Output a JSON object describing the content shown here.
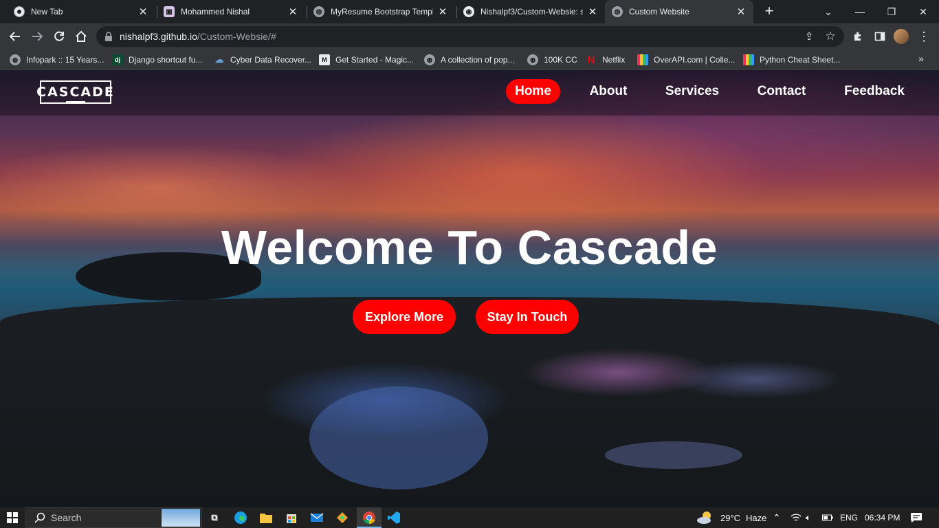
{
  "browser": {
    "tabs": [
      {
        "title": "New Tab",
        "icon": "chrome-icon",
        "active": false
      },
      {
        "title": "Mohammed Nishal",
        "icon": "site-icon",
        "active": false
      },
      {
        "title": "MyResume Bootstrap Templa",
        "icon": "globe-icon",
        "active": false
      },
      {
        "title": "Nishalpf3/Custom-Websie: s",
        "icon": "github-icon",
        "active": false
      },
      {
        "title": "Custom Website",
        "icon": "globe-icon",
        "active": true
      }
    ],
    "address": {
      "domain": "nishalpf3.github.io",
      "path": "/Custom-Websie/#"
    },
    "bookmarks": [
      {
        "label": "Infopark :: 15 Years...",
        "icon": "globe-icon"
      },
      {
        "label": "Django shortcut fu...",
        "icon": "django-icon"
      },
      {
        "label": "Cyber Data Recover...",
        "icon": "cloud-icon"
      },
      {
        "label": "Get Started - Magic...",
        "icon": "magic-icon"
      },
      {
        "label": "A collection of pop...",
        "icon": "globe-icon"
      },
      {
        "label": "100K CC",
        "icon": "globe-icon"
      },
      {
        "label": "Netflix",
        "icon": "netflix-icon"
      },
      {
        "label": "OverAPI.com | Colle...",
        "icon": "overapi-icon"
      },
      {
        "label": "Python Cheat Sheet...",
        "icon": "overapi-icon"
      }
    ]
  },
  "page": {
    "logo": "CASCADE",
    "nav": [
      "Home",
      "About",
      "Services",
      "Contact",
      "Feedback"
    ],
    "active_nav": "Home",
    "hero_title": "Welcome To Cascade",
    "buttons": [
      "Explore More",
      "Stay In Touch"
    ],
    "accent_color": "#ff0000"
  },
  "taskbar": {
    "search_placeholder": "Search",
    "weather": "29°C",
    "weather_desc": "Haze",
    "language": "ENG",
    "time": "06:34 PM"
  }
}
